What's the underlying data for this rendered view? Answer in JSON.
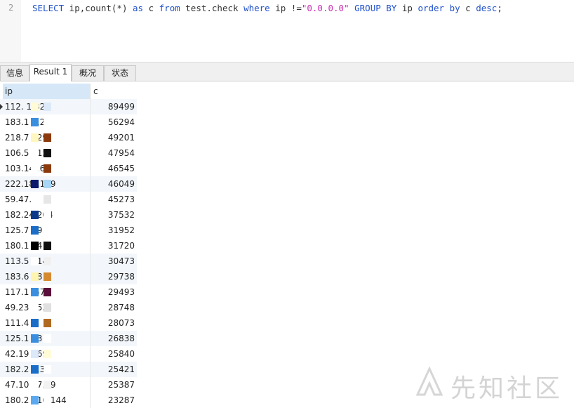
{
  "editor": {
    "line_number": "2",
    "sql": {
      "select": "SELECT",
      "cols": " ip,count(*) ",
      "as": "as",
      "alias": " c ",
      "from": "from",
      "table": " test.check ",
      "where": "where",
      "cond": " ip !=",
      "value": "\"0.0.0.0\"",
      "group_by": " GROUP BY",
      "gb_col": " ip ",
      "order_by": "order by",
      "ob_col": " c ",
      "desc": "desc",
      "end": ";"
    }
  },
  "tabs": [
    {
      "label": "信息"
    },
    {
      "label": "Result 1"
    },
    {
      "label": "概况"
    },
    {
      "label": "状态"
    }
  ],
  "grid": {
    "columns": [
      "ip",
      "c"
    ],
    "rows": [
      {
        "ip": "112.    1.32",
        "c": "89499"
      },
      {
        "ip": "183.1      .129",
        "c": "56294"
      },
      {
        "ip": "218.7      129",
        "c": "49201"
      },
      {
        "ip": "106.5      215",
        "c": "47954"
      },
      {
        "ip": "103.14      .6",
        "c": "46545"
      },
      {
        "ip": "222.18      .169",
        "c": "46049"
      },
      {
        "ip": "59.47.      ",
        "c": "45273"
      },
      {
        "ip": "182.24      204",
        "c": "37532"
      },
      {
        "ip": "125.7      39",
        "c": "31952"
      },
      {
        "ip": "180.1      34",
        "c": "31720"
      },
      {
        "ip": "113.5      214",
        "c": "30473"
      },
      {
        "ip": "183.6      98",
        "c": "29738"
      },
      {
        "ip": "117.1      .57",
        "c": "29493"
      },
      {
        "ip": "49.23      253",
        "c": "28748"
      },
      {
        "ip": "111.4      7",
        "c": "28073"
      },
      {
        "ip": "125.1      43",
        "c": "26838"
      },
      {
        "ip": "42.19      169",
        "c": "25840"
      },
      {
        "ip": "182.2      .13",
        "c": "25421"
      },
      {
        "ip": "47.10    87.19",
        "c": "25387"
      },
      {
        "ip": "180.2    116.144",
        "c": "23287"
      }
    ]
  },
  "watermark": {
    "text": "先知社区"
  },
  "colors": {
    "keyword": "#1e50c8",
    "string": "#c82fb4",
    "header_selected": "#d6e8f7"
  }
}
